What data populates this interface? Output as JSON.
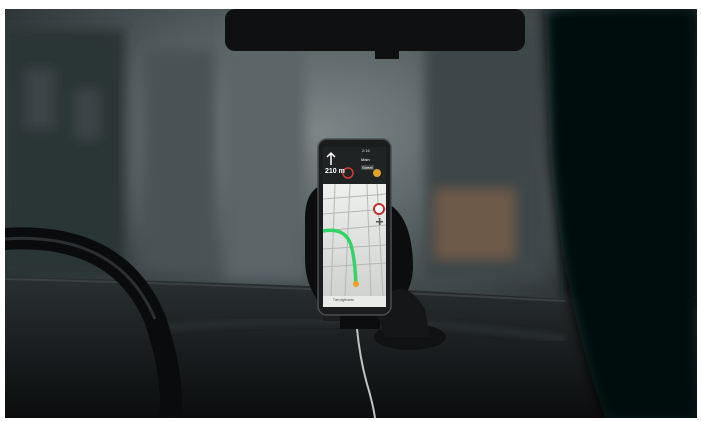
{
  "scene": {
    "description_colors": {
      "windshield_light": "#6f7a7c",
      "dashboard": "#1e2224",
      "shadow": "#050606",
      "route_green": "#34d36a",
      "map_bg": "#d9dcd8"
    }
  },
  "phone": {
    "status_time": "2:16",
    "distance": "210 m",
    "street_top": "Main",
    "street_bottom": "Street",
    "bottom_text": "Turn right onto"
  }
}
